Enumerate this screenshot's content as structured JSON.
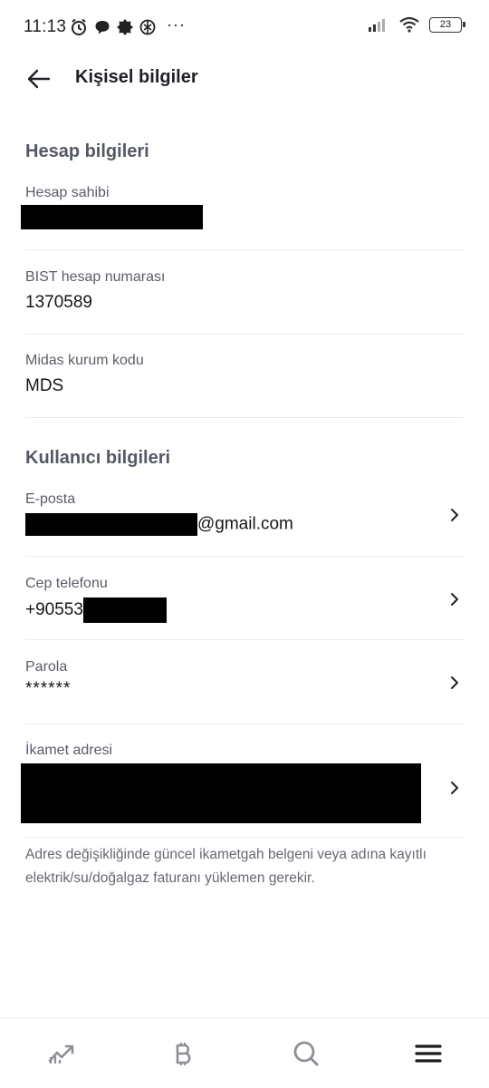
{
  "status_bar": {
    "time": "11:13",
    "more": "···",
    "battery": "23"
  },
  "header": {
    "title": "Kişisel bilgiler"
  },
  "account_section": {
    "title": "Hesap bilgileri",
    "holder_label": "Hesap sahibi",
    "bist_label": "BIST hesap numarası",
    "bist_value": "1370589",
    "midas_label": "Midas kurum kodu",
    "midas_value": "MDS"
  },
  "user_section": {
    "title": "Kullanıcı bilgileri",
    "email_label": "E-posta",
    "email_suffix": "@gmail.com",
    "phone_label": "Cep telefonu",
    "phone_prefix": "+90553",
    "password_label": "Parola",
    "password_value": "******",
    "address_label": "İkamet adresi"
  },
  "note": "Adres değişikliğinde güncel ikametgah belgeni veya adına kayıtlı elektrik/su/doğalgaz faturanı yüklemen gerekir.",
  "icons": {
    "back": "arrow-left-icon",
    "chevron": "chevron-right-icon",
    "nav": [
      "chart-trend-icon",
      "bitcoin-icon",
      "search-icon",
      "menu-icon"
    ]
  },
  "colors": {
    "accent": "#1f1f28",
    "muted": "#5a5d68",
    "redaction": "#000000"
  }
}
